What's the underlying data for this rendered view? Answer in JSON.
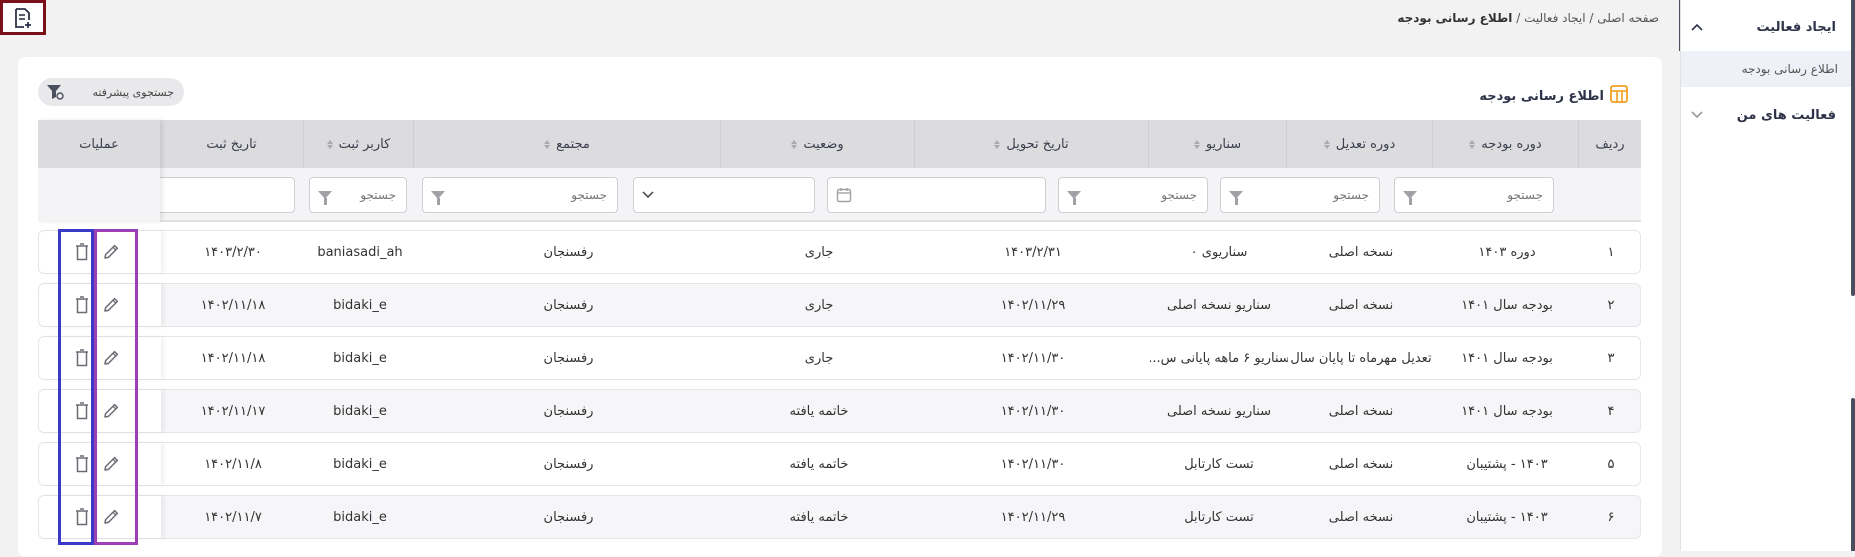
{
  "toolbar": {
    "add_report_icon": "add-document-icon"
  },
  "breadcrumb": {
    "home": "صفحه اصلی",
    "sep1": " / ",
    "section": "ایجاد فعالیت",
    "sep2": " / ",
    "current": "اطلاع رسانی بودجه"
  },
  "sidebar": {
    "items": [
      {
        "label": "ایجاد فعالیت",
        "icon": "chevron-up-icon",
        "expanded": true
      },
      {
        "label": "فعالیت های من",
        "icon": "chevron-down-icon",
        "expanded": false
      }
    ],
    "subitems": [
      {
        "label": "اطلاع رسانی بودجه",
        "active": true
      }
    ]
  },
  "card": {
    "title": "اطلاع رسانی بودجه",
    "title_icon": "table-icon",
    "advanced_search": "جستجوی پیشرفته"
  },
  "table": {
    "columns": [
      "ردیف",
      "دوره بودجه",
      "دوره تعدیل",
      "سناریو",
      "تاریخ تحویل",
      "وضعیت",
      "مجتمع",
      "کاربر ثبت",
      "تاریخ ثبت",
      "عملیات"
    ],
    "filter_placeholder": "جستجو",
    "rows": [
      {
        "idx": "۱",
        "period": "دوره ۱۴۰۳",
        "adjust": "نسخه اصلی",
        "scenario": "سناریوی ۰",
        "delivery": "۱۴۰۳/۲/۳۱",
        "status": "جاری",
        "complex": "رفسنجان",
        "user": "baniasadi_ah",
        "created": "۱۴۰۳/۲/۳۰"
      },
      {
        "idx": "۲",
        "period": "بودجه سال ۱۴۰۱",
        "adjust": "نسخه اصلی",
        "scenario": "سناریو نسخه اصلی",
        "delivery": "۱۴۰۲/۱۱/۲۹",
        "status": "جاری",
        "complex": "رفسنجان",
        "user": "bidaki_e",
        "created": "۱۴۰۲/۱۱/۱۸"
      },
      {
        "idx": "۳",
        "period": "بودجه سال ۱۴۰۱",
        "adjust": "تعدیل مهرماه تا پایان سال",
        "scenario": "سناریو ۶ ماهه پایانی س...",
        "delivery": "۱۴۰۲/۱۱/۳۰",
        "status": "جاری",
        "complex": "رفسنجان",
        "user": "bidaki_e",
        "created": "۱۴۰۲/۱۱/۱۸"
      },
      {
        "idx": "۴",
        "period": "بودجه سال ۱۴۰۱",
        "adjust": "نسخه اصلی",
        "scenario": "سناریو نسخه اصلی",
        "delivery": "۱۴۰۲/۱۱/۳۰",
        "status": "خاتمه یافته",
        "complex": "رفسنجان",
        "user": "bidaki_e",
        "created": "۱۴۰۲/۱۱/۱۷"
      },
      {
        "idx": "۵",
        "period": "۱۴۰۳ - پشتیبان",
        "adjust": "نسخه اصلی",
        "scenario": "تست کارتابل",
        "delivery": "۱۴۰۲/۱۱/۳۰",
        "status": "خاتمه یافته",
        "complex": "رفسنجان",
        "user": "bidaki_e",
        "created": "۱۴۰۲/۱۱/۸"
      },
      {
        "idx": "۶",
        "period": "۱۴۰۳ - پشتیبان",
        "adjust": "نسخه اصلی",
        "scenario": "تست کارتابل",
        "delivery": "۱۴۰۲/۱۱/۲۹",
        "status": "خاتمه یافته",
        "complex": "رفسنجان",
        "user": "bidaki_e",
        "created": "۱۴۰۲/۱۱/۷"
      }
    ]
  },
  "row_actions": {
    "edit_icon": "pencil-icon",
    "delete_icon": "trash-icon"
  },
  "colors": {
    "accent": "#f0a020",
    "highlight_delete": "#3a3ac8",
    "highlight_edit": "#9b40b8",
    "highlight_add": "#7a1018"
  }
}
